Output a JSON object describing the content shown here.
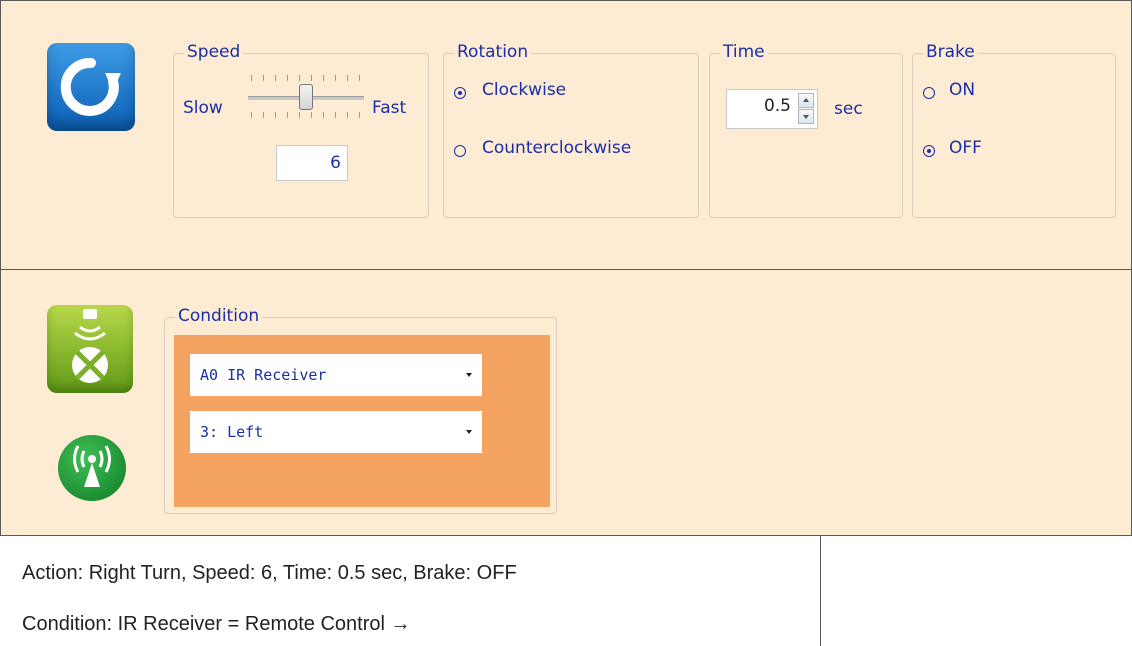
{
  "action": {
    "icon": "rotate-clockwise-icon",
    "speed": {
      "legend": "Speed",
      "slow": "Slow",
      "fast": "Fast",
      "value": "6",
      "level": 0.5
    },
    "rotation": {
      "legend": "Rotation",
      "options": [
        "Clockwise",
        "Counterclockwise"
      ],
      "selected": "Clockwise"
    },
    "time": {
      "legend": "Time",
      "value": "0.5",
      "unit": "sec"
    },
    "brake": {
      "legend": "Brake",
      "options": [
        "ON",
        "OFF"
      ],
      "selected": "OFF"
    }
  },
  "condition": {
    "sensor_icon": "ir-receiver-icon",
    "remote_icon": "wireless-signal-icon",
    "legend": "Condition",
    "sensor_select": "A0 IR Receiver",
    "value_select": "3: Left",
    "panel_color": "#f4a460"
  },
  "summary": {
    "line1": "Action: Right Turn, Speed: 6, Time: 0.5 sec, Brake: OFF",
    "line2": "Condition: IR Receiver = Remote Control →"
  },
  "colors": {
    "panel_bg": "#fdebd3",
    "label_blue": "#1a2fa8",
    "accent_orange": "#f4a460"
  }
}
